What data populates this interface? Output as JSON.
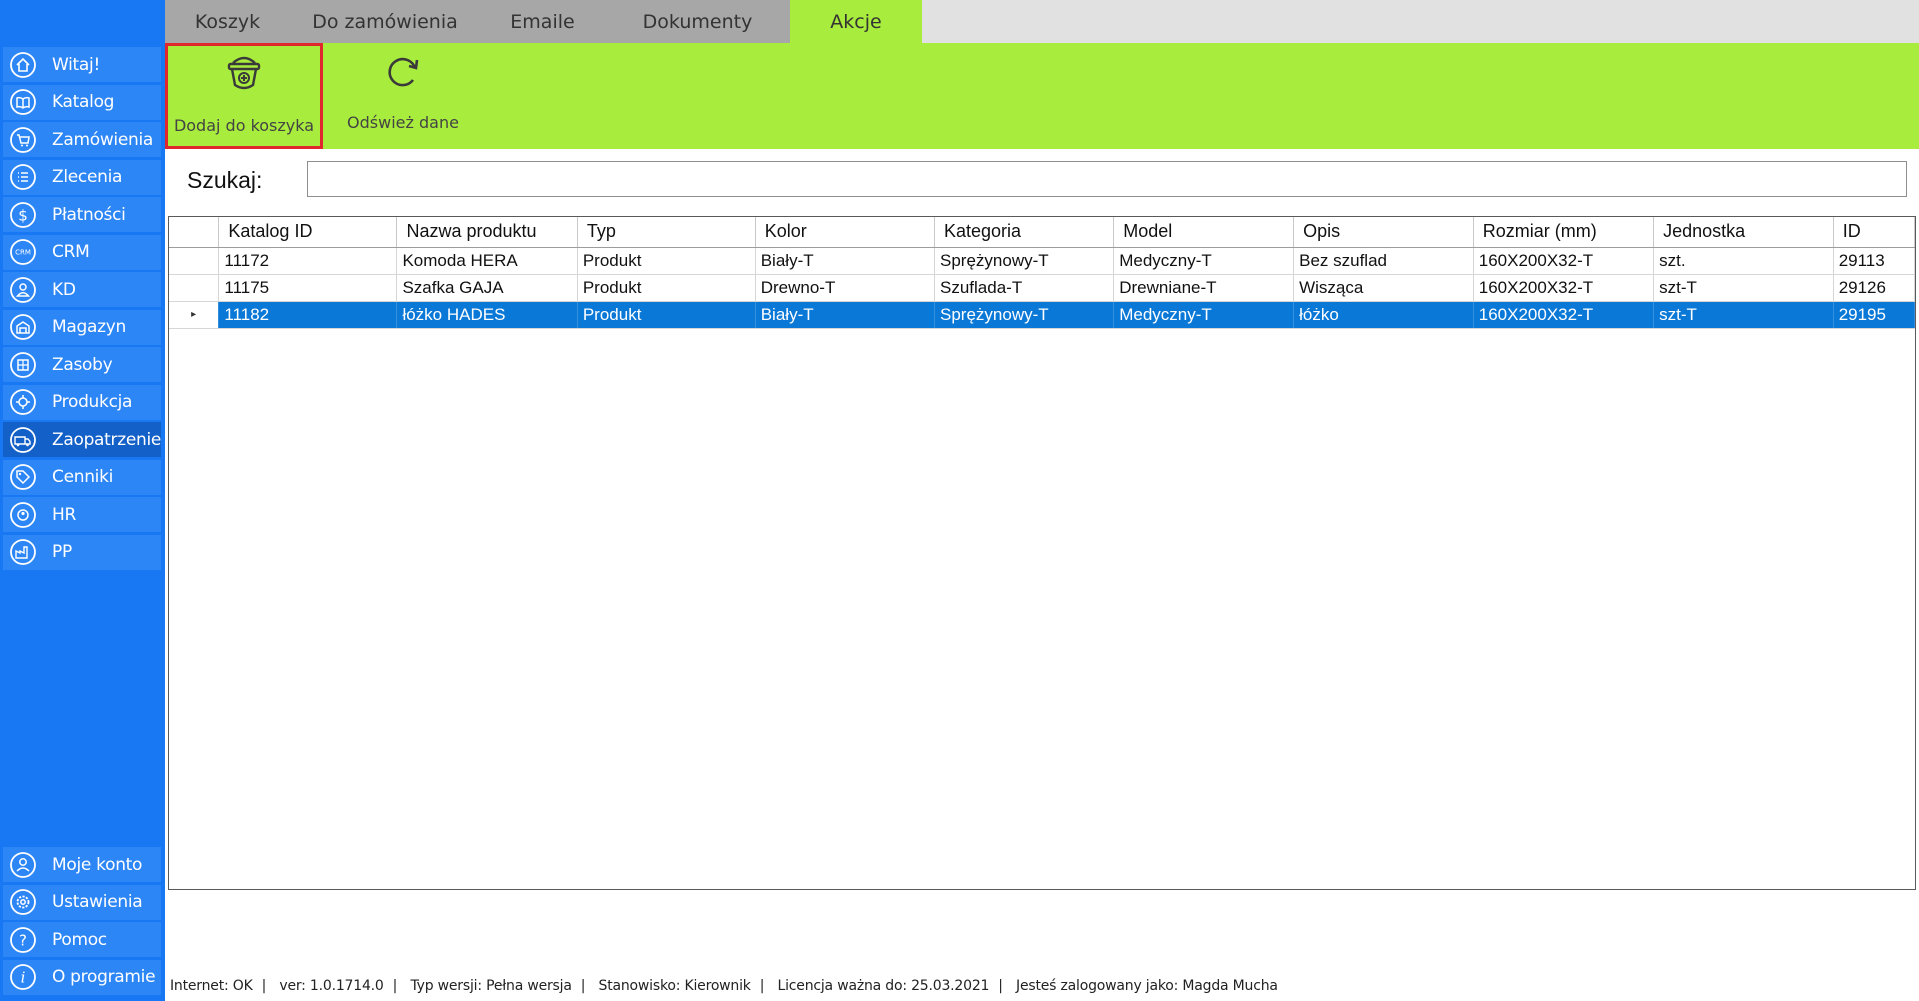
{
  "tabs": [
    {
      "label": "Koszyk",
      "active": false
    },
    {
      "label": "Do zamówienia",
      "active": false
    },
    {
      "label": "Emaile",
      "active": false
    },
    {
      "label": "Dokumenty",
      "active": false
    },
    {
      "label": "Akcje",
      "active": true
    }
  ],
  "ribbon": {
    "add_to_cart": {
      "label": "Dodaj do koszyka",
      "icon": "basket-add-icon"
    },
    "refresh": {
      "label": "Odśwież dane",
      "icon": "refresh-icon"
    }
  },
  "sidebar": {
    "items": [
      {
        "label": "Witaj!",
        "icon": "home-icon"
      },
      {
        "label": "Katalog",
        "icon": "book-icon"
      },
      {
        "label": "Zamówienia",
        "icon": "cart-icon"
      },
      {
        "label": "Zlecenia",
        "icon": "list-icon"
      },
      {
        "label": "Płatności",
        "icon": "dollar-icon"
      },
      {
        "label": "CRM",
        "icon": "crm-icon"
      },
      {
        "label": "KD",
        "icon": "contacts-icon"
      },
      {
        "label": "Magazyn",
        "icon": "warehouse-icon"
      },
      {
        "label": "Zasoby",
        "icon": "resources-icon"
      },
      {
        "label": "Produkcja",
        "icon": "production-icon"
      },
      {
        "label": "Zaopatrzenie",
        "icon": "truck-icon",
        "active": true
      },
      {
        "label": "Cenniki",
        "icon": "price-tag-icon"
      },
      {
        "label": "HR",
        "icon": "hr-icon"
      },
      {
        "label": "PP",
        "icon": "factory-icon"
      }
    ],
    "bottom": [
      {
        "label": "Moje konto",
        "icon": "user-icon"
      },
      {
        "label": "Ustawienia",
        "icon": "gear-icon"
      },
      {
        "label": "Pomoc",
        "icon": "help-icon"
      },
      {
        "label": "O programie",
        "icon": "info-icon"
      }
    ]
  },
  "search": {
    "label": "Szukaj:",
    "value": "",
    "placeholder": ""
  },
  "grid": {
    "columns": [
      "Katalog ID",
      "Nazwa produktu",
      "Typ",
      "Kolor",
      "Kategoria",
      "Model",
      "Opis",
      "Rozmiar (mm)",
      "Jednostka",
      "ID"
    ],
    "rows": [
      [
        "11172",
        "Komoda HERA",
        "Produkt",
        "Biały-T",
        "Sprężynowy-T",
        "Medyczny-T",
        "Bez szuflad",
        "160X200X32-T",
        "szt.",
        "29113"
      ],
      [
        "11175",
        "Szafka GAJA",
        "Produkt",
        "Drewno-T",
        "Szuflada-T",
        "Drewniane-T",
        "Wisząca",
        "160X200X32-T",
        "szt-T",
        "29126"
      ],
      [
        "11182",
        "łóżko HADES",
        "Produkt",
        "Biały-T",
        "Sprężynowy-T",
        "Medyczny-T",
        "łóżko",
        "160X200X32-T",
        "szt-T",
        "29195"
      ]
    ],
    "selected_row": 2,
    "row_marker": "▸"
  },
  "status": {
    "internet": "Internet: OK",
    "version": "ver: 1.0.1714.0",
    "type": "Typ wersji: Pełna wersja",
    "position": "Stanowisko: Kierownik",
    "license": "Licencja ważna do: 25.03.2021",
    "user": "Jesteś zalogowany jako: Magda Mucha",
    "separator": "|"
  },
  "colors": {
    "sidebar": "#1877f2",
    "accent_green": "#a8ec3d",
    "selection": "#0a78d7",
    "highlight_border": "#e0282c"
  }
}
